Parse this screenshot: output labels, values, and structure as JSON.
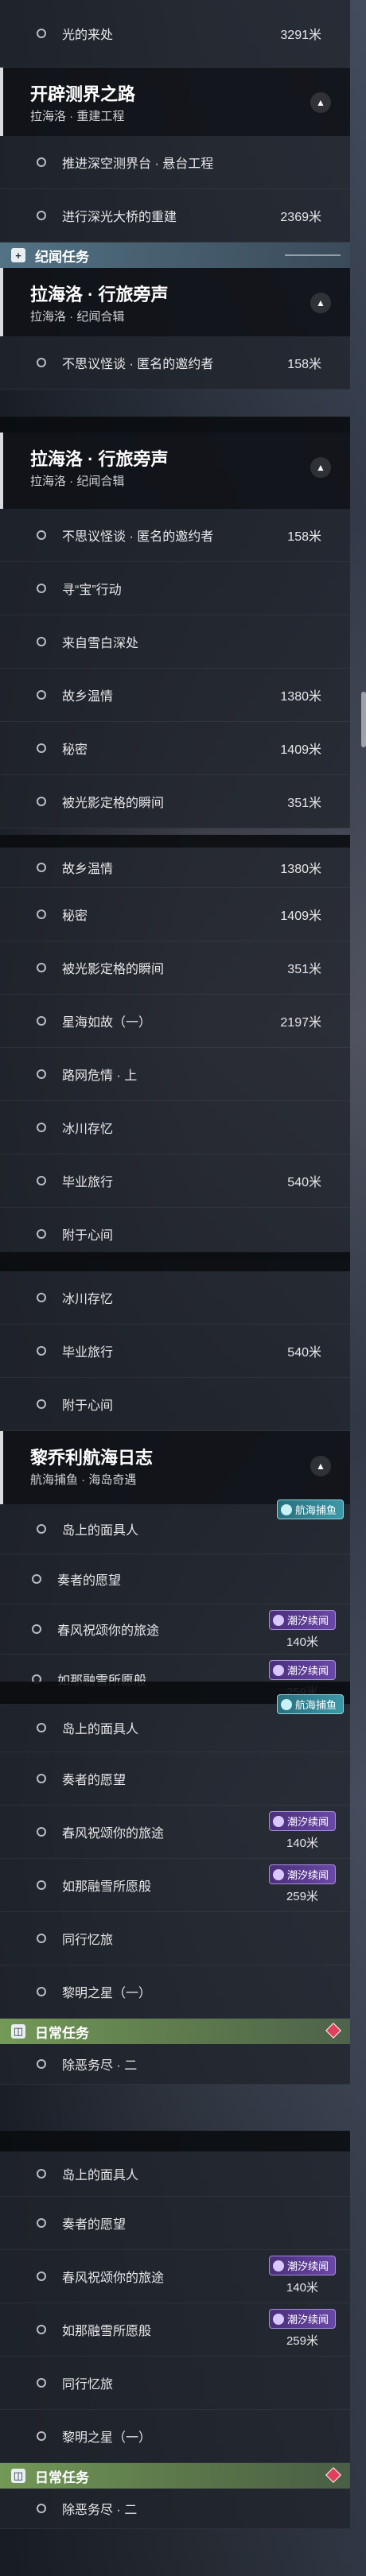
{
  "q": {
    "light_origin": "光的来处",
    "light_origin_dist": "3291米",
    "quest_kaipi": "开辟测界之路",
    "quest_kaipi_sub": "拉海洛 · 重建工程",
    "tuijin": "推进深空测界台 · 悬台工程",
    "shenliu": "进行深光大桥的重建",
    "shenliu_dist": "2369米",
    "lvlu": "拉海洛 · 行旅旁声",
    "lvlu_sub": "拉海洛 · 纪闻合辑",
    "bukesiyi": "不思议怪谈 · 匿名的邀约者",
    "bukesiyi_dist": "158米",
    "xunbao": "寻“宝”行动",
    "laizi": "来自雪白深处",
    "guxiang": "故乡温情",
    "guxiang_dist": "1380米",
    "mimi": "秘密",
    "mimi_dist": "1409米",
    "beiguang": "被光影定格的瞬间",
    "beiguang_dist": "351米",
    "xinghai": "星海如故（一）",
    "xinghai_dist": "2197米",
    "luwang": "路网危情 · 上",
    "bingchuan": "冰川存忆",
    "biye": "毕业旅行",
    "biye_dist": "540米",
    "zhiyu": "附于心间",
    "liqiao": "黎乔利航海日志",
    "liqiao_sub": "航海捕鱼 · 海岛奇遇",
    "daoshang": "岛上的面具人",
    "zouzhe": "奏者的愿望",
    "chunfeng": "春风祝颂你的旅途",
    "chunfeng_dist": "140米",
    "rurong": "如那融雪所愿般",
    "rurong_dist": "259米",
    "tongxing": "同行忆旅",
    "liming": "黎明之星（一）",
    "chuzhu": "除恶务尽 · 二",
    "tag_chaoxi": "潮汐续闻",
    "tag_hanghai": "航海捕鱼"
  },
  "cats": {
    "jiwen": "纪闻任务",
    "richang": "日常任务"
  },
  "icons": {
    "chevron": "chevron-up-icon",
    "circle": "circle-icon",
    "cat_plus": "+",
    "cat_book": "◫"
  },
  "colors": {
    "accent_teal": "#3b98a8",
    "accent_purple": "#6a48a8",
    "accent_green": "#78a05a",
    "marker_red": "#e0405a"
  }
}
